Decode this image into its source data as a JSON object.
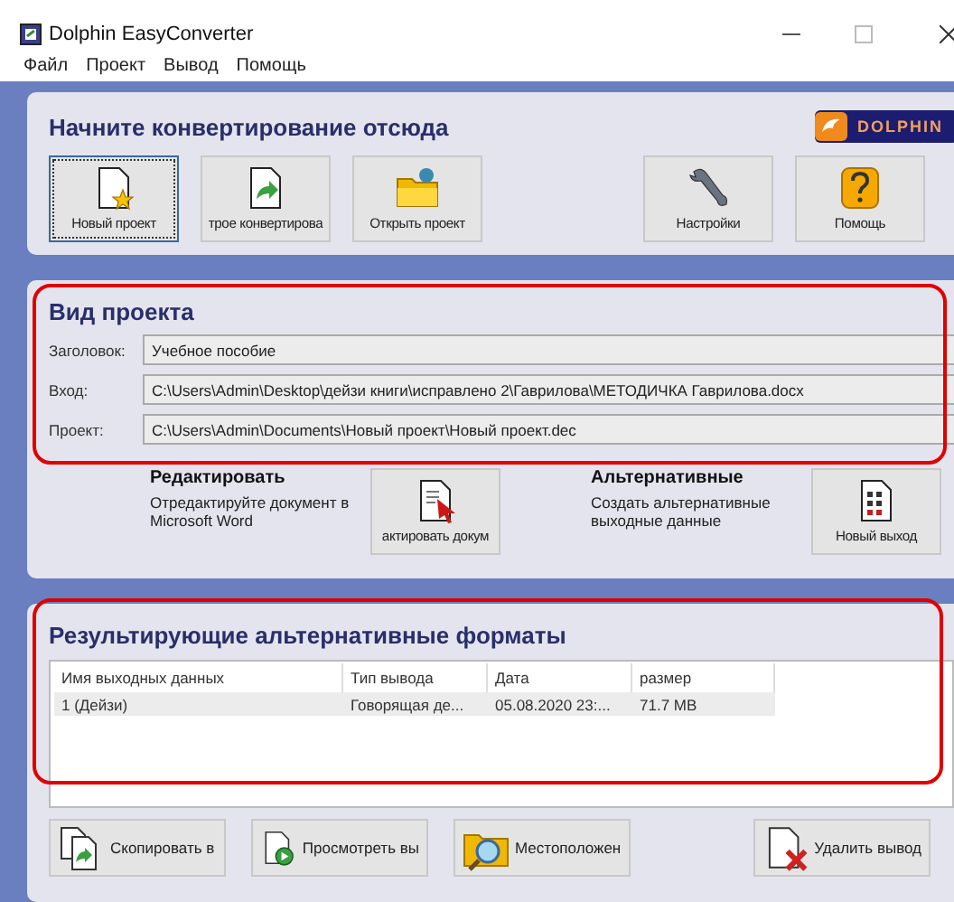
{
  "window": {
    "title": "Dolphin EasyConverter"
  },
  "menu": [
    "Файл",
    "Проект",
    "Вывод",
    "Помощь"
  ],
  "start_panel": {
    "title": "Начните конвертирование отсюда",
    "logo": "DOLPHIN",
    "buttons_left": [
      {
        "kind": "new",
        "label": "Новый проект",
        "selected": true
      },
      {
        "kind": "convert",
        "label": "трое конвертирова",
        "selected": false
      },
      {
        "kind": "open",
        "label": "Открыть проект",
        "selected": false
      }
    ],
    "buttons_right": [
      {
        "kind": "settings",
        "label": "Настройки",
        "selected": false
      },
      {
        "kind": "help",
        "label": "Помощь",
        "selected": false
      }
    ]
  },
  "project_panel": {
    "title": "Вид проекта",
    "highlighted": true,
    "fields": [
      {
        "label": "Заголовок:",
        "value": "Учебное пособие"
      },
      {
        "label": "Вход:",
        "value": "C:\\Users\\Admin\\Desktop\\дейзи книги\\исправлено 2\\Гаврилова\\МЕТОДИЧКА Гаврилова.docx"
      },
      {
        "label": "Проект:",
        "value": "C:\\Users\\Admin\\Documents\\Новый проект\\Новый проект.dec"
      }
    ],
    "actions": [
      {
        "kind": "edit",
        "heading": "Редактировать",
        "description": "Отредактируйте документ в Microsoft Word",
        "button": "актировать докум"
      },
      {
        "kind": "new-output",
        "heading": "Альтернативные",
        "description": "Создать альтернативные выходные данные",
        "button": "Новый выход"
      }
    ]
  },
  "results_panel": {
    "title": "Результирующие альтернативные форматы",
    "highlighted": true,
    "table": {
      "columns": [
        "Имя выходных данных",
        "Тип вывода",
        "Дата",
        "размер"
      ],
      "rows": [
        {
          "cells": [
            "1 (Дейзи)",
            "Говорящая де...",
            "05.08.2020 23:...",
            "71.7 MB"
          ],
          "selected": true
        }
      ]
    },
    "buttons": [
      {
        "kind": "copy",
        "label": "Скопировать в"
      },
      {
        "kind": "view",
        "label": "Просмотреть вы"
      },
      {
        "kind": "locate",
        "label": "Местоположен"
      },
      {
        "kind": "delete",
        "label": "Удалить вывод"
      }
    ]
  }
}
